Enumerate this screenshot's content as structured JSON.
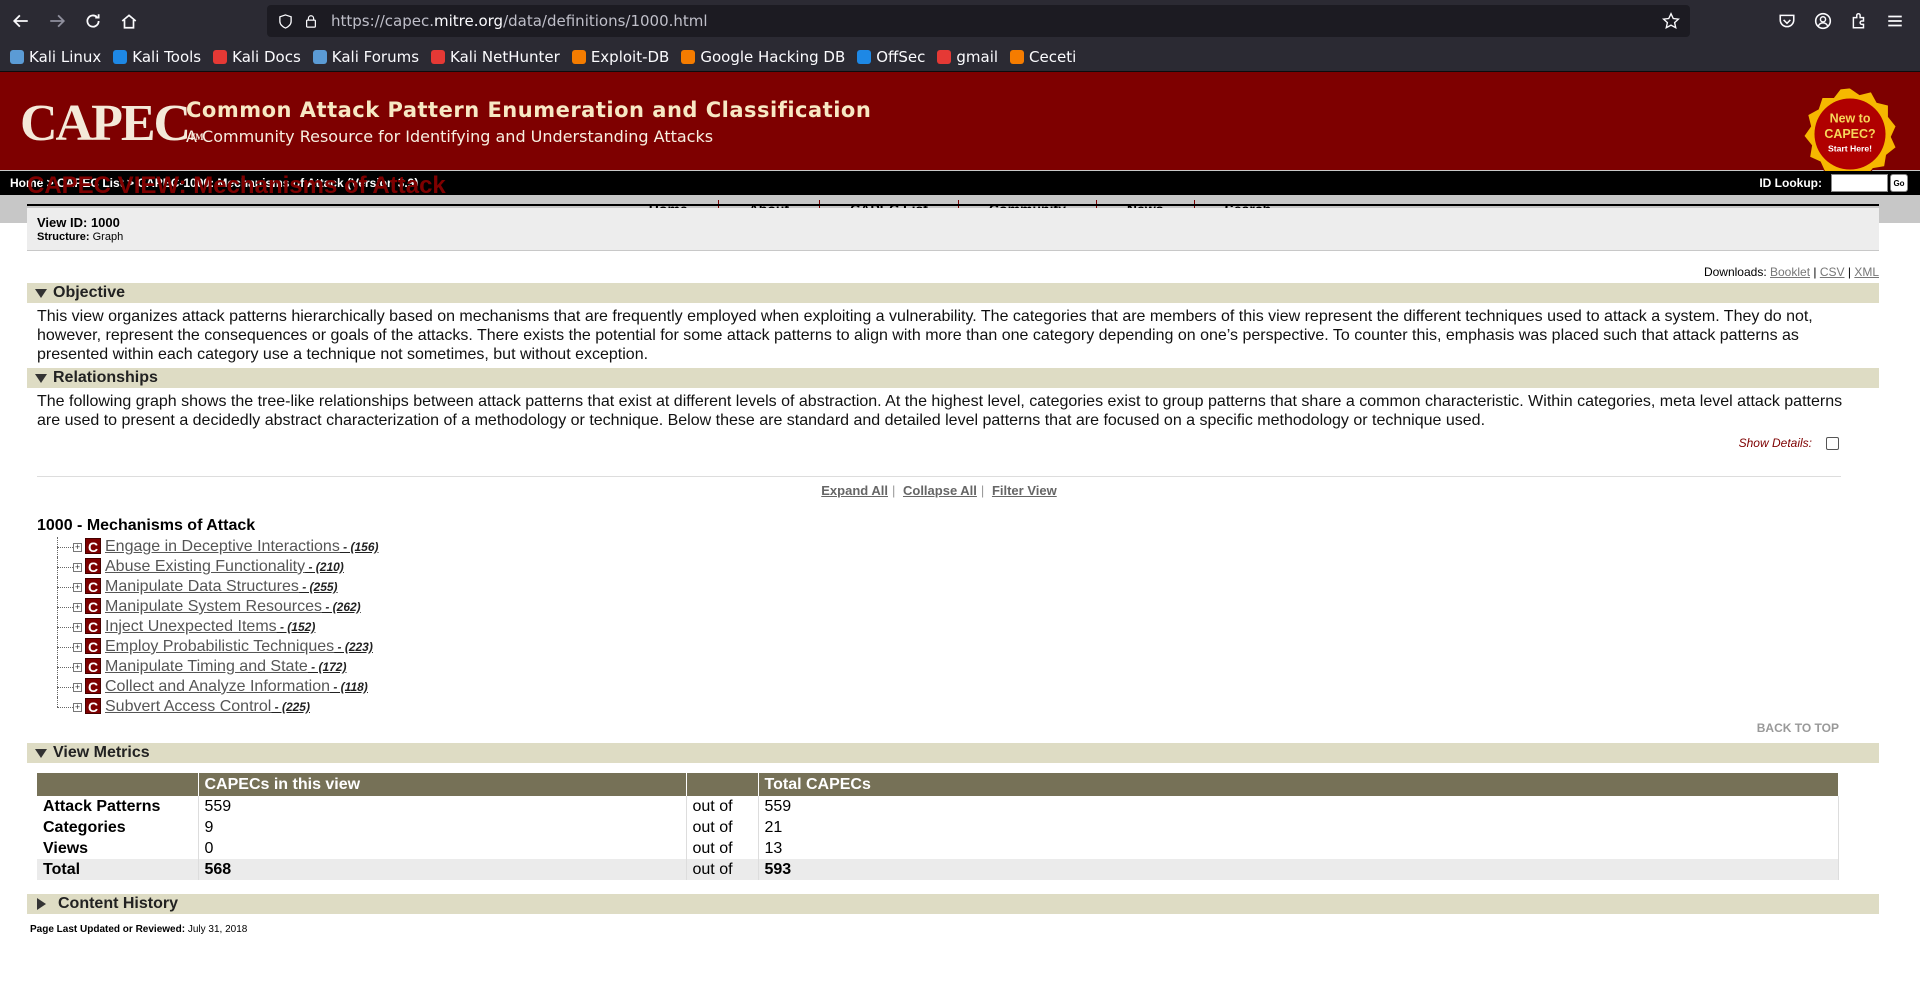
{
  "browser": {
    "url_prefix": "https://capec.",
    "url_host": "mitre.org",
    "url_path": "/data/definitions/1000.html",
    "bookmarks": [
      {
        "label": "Kali Linux",
        "color": "#5b9bd5"
      },
      {
        "label": "Kali Tools",
        "color": "#1e88e5"
      },
      {
        "label": "Kali Docs",
        "color": "#e53935"
      },
      {
        "label": "Kali Forums",
        "color": "#5b9bd5"
      },
      {
        "label": "Kali NetHunter",
        "color": "#e53935"
      },
      {
        "label": "Exploit-DB",
        "color": "#f57c00"
      },
      {
        "label": "Google Hacking DB",
        "color": "#f57c00"
      },
      {
        "label": "OffSec",
        "color": "#1e88e5"
      },
      {
        "label": "gmail",
        "color": "#e53935"
      },
      {
        "label": "Ceceti",
        "color": "#f57c00"
      }
    ]
  },
  "banner": {
    "logo": "CAPEC",
    "tm": "TM",
    "title": "Common Attack Pattern Enumeration and Classification",
    "subtitle": "A Community Resource for Identifying and Understanding Attacks",
    "badge_line1": "New to",
    "badge_line2": "CAPEC?",
    "badge_line3": "Start Here!"
  },
  "crumbs": {
    "text": "Home > CAPEC List > CAPEC-1000: Mechanisms of Attack (Version 3.9)",
    "id_lookup_label": "ID Lookup:",
    "go_label": "Go"
  },
  "menu": [
    "Home",
    "About",
    "CAPEC List",
    "Community",
    "News",
    "Search"
  ],
  "page": {
    "title": "CAPEC VIEW: Mechanisms of Attack",
    "view_id": "View ID: 1000",
    "structure_label": "Structure:",
    "structure_value": "Graph",
    "downloads_label": "Downloads:",
    "downloads": [
      "Booklet",
      "CSV",
      "XML"
    ]
  },
  "objective": {
    "heading": "Objective",
    "text": "This view organizes attack patterns hierarchically based on mechanisms that are frequently employed when exploiting a vulnerability. The categories that are members of this view represent the different techniques used to attack a system. They do not, however, represent the consequences or goals of the attacks. There exists the potential for some attack patterns to align with more than one category depending on one’s perspective. To counter this, emphasis was placed such that attack patterns as presented within each category use a technique not sometimes, but without exception."
  },
  "relationships": {
    "heading": "Relationships",
    "text": "The following graph shows the tree-like relationships between attack patterns that exist at different levels of abstraction. At the highest level, categories exist to group patterns that share a common characteristic. Within categories, meta level attack patterns are used to present a decidedly abstract characterization of a methodology or technique. Below these are standard and detailed level patterns that are focused on a specific methodology or technique used.",
    "show_details": "Show Details:",
    "expand_all": "Expand All",
    "collapse_all": "Collapse All",
    "filter_view": "Filter View",
    "root": "1000 - Mechanisms of Attack",
    "items": [
      {
        "label": "Engage in Deceptive Interactions",
        "count": " - (156)"
      },
      {
        "label": "Abuse Existing Functionality",
        "count": " - (210)"
      },
      {
        "label": "Manipulate Data Structures",
        "count": " - (255)"
      },
      {
        "label": "Manipulate System Resources",
        "count": " - (262)"
      },
      {
        "label": "Inject Unexpected Items",
        "count": " - (152)"
      },
      {
        "label": "Employ Probabilistic Techniques",
        "count": " - (223)"
      },
      {
        "label": "Manipulate Timing and State",
        "count": " - (172)"
      },
      {
        "label": "Collect and Analyze Information",
        "count": " - (118)"
      },
      {
        "label": "Subvert Access Control",
        "count": " - (225)"
      }
    ],
    "badge": "C",
    "back_to_top": "BACK TO TOP"
  },
  "metrics": {
    "heading": "View Metrics",
    "col_view": "CAPECs in this view",
    "col_total": "Total CAPECs",
    "rows": [
      {
        "label": "Attack Patterns",
        "view": "559",
        "of": "out of",
        "total": "559"
      },
      {
        "label": "Categories",
        "view": "9",
        "of": "out of",
        "total": "21"
      },
      {
        "label": "Views",
        "view": "0",
        "of": "out of",
        "total": "13"
      },
      {
        "label": "Total",
        "view": "568",
        "of": "out of",
        "total": "593"
      }
    ]
  },
  "content_history": {
    "heading": "Content History"
  },
  "footer": {
    "updated_label": "Page Last Updated or Reviewed:",
    "updated_value": "July 31, 2018"
  }
}
